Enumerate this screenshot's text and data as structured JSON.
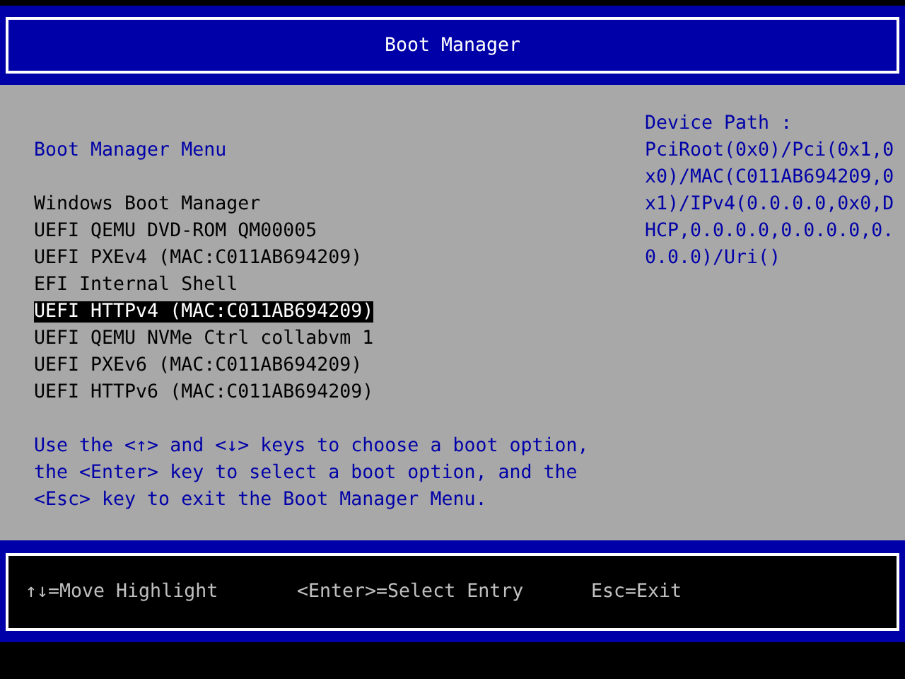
{
  "window": {
    "title": "Boot Manager"
  },
  "menu_title": "Boot Manager Menu",
  "boot_options": [
    {
      "label": "Windows Boot Manager",
      "selected": false
    },
    {
      "label": "UEFI QEMU DVD-ROM QM00005",
      "selected": false
    },
    {
      "label": "UEFI PXEv4 (MAC:C011AB694209)",
      "selected": false
    },
    {
      "label": "EFI Internal Shell",
      "selected": false
    },
    {
      "label": "UEFI HTTPv4 (MAC:C011AB694209)",
      "selected": true
    },
    {
      "label": "UEFI QEMU NVMe Ctrl collabvm 1",
      "selected": false
    },
    {
      "label": "UEFI PXEv6 (MAC:C011AB694209)",
      "selected": false
    },
    {
      "label": "UEFI HTTPv6 (MAC:C011AB694209)",
      "selected": false
    }
  ],
  "help_text": "Use the <↑> and <↓> keys to choose a boot option, the <Enter> key to select a boot option, and the <Esc> key to exit the Boot Manager Menu.",
  "device_path": {
    "label": "Device Path :",
    "value": "PciRoot(0x0)/Pci(0x1,0x0)/MAC(C011AB694209,0x1)/IPv4(0.0.0.0,0x0,DHCP,0.0.0.0,0.0.0.0,0.0.0.0)/Uri()"
  },
  "status_bar": [
    "↑↓=Move Highlight",
    "<Enter>=Select Entry",
    "Esc=Exit"
  ]
}
